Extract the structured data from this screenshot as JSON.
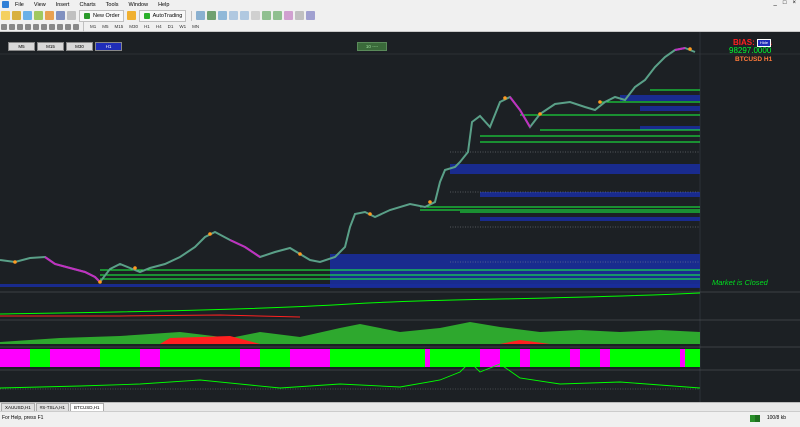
{
  "menu": [
    "File",
    "View",
    "Insert",
    "Charts",
    "Tools",
    "Window",
    "Help"
  ],
  "window_controls": [
    "_",
    "□",
    "×"
  ],
  "toolbar": {
    "new_order": "New Order",
    "autotrading": "AutoTrading"
  },
  "timeframes_toolbar": [
    "M1",
    "M5",
    "M15",
    "M30",
    "H1",
    "H4",
    "D1",
    "W1",
    "MN"
  ],
  "chart_buttons": [
    {
      "label": "M5",
      "active": false
    },
    {
      "label": "M15",
      "active": false
    },
    {
      "label": "M30",
      "active": false
    },
    {
      "label": "H1",
      "active": true
    }
  ],
  "overlay": {
    "on_tag": "10  ----",
    "bias": "BIAS: Bea",
    "price": "98297.0000",
    "symbol": "BTCUSD  H1",
    "hide": "Hide",
    "market_closed": "Market is Closed"
  },
  "tabs": [
    {
      "label": "XAUUSD,H1",
      "active": false
    },
    {
      "label": "#S-TSLA,H1",
      "active": false
    },
    {
      "label": "BTCUSD,H1",
      "active": true
    }
  ],
  "status": {
    "help": "For Help, press F1",
    "traffic": "100/8 kb"
  },
  "colors": {
    "chart_bg": "#1c2024",
    "price_line": "#5aa088",
    "bear_segment": "#c030c0",
    "blue_zone": "#1a2c9a",
    "green_level": "#18ff40",
    "magenta_hist": "#ff00ff",
    "green_hist": "#00ff00"
  }
}
